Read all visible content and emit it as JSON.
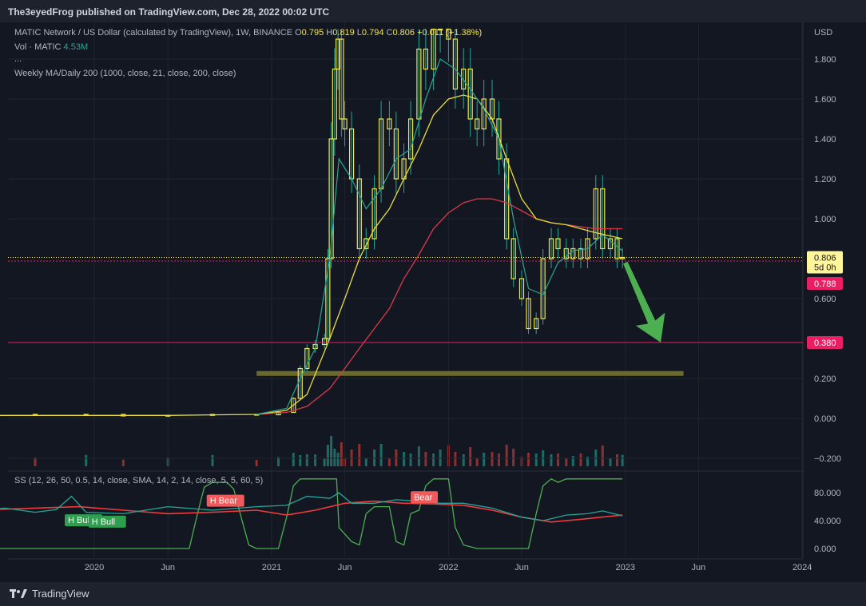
{
  "published_by": "The3eyedFrog published on TradingView.com, Dec 28, 2022 00:02 UTC",
  "brand": "TradingView",
  "legend": {
    "symbol": "MATIC Network / US Dollar (calculated by TradingView), 1W, BINANCE",
    "o_label": "O",
    "o_val": "0.795",
    "h_label": "H",
    "h_val": "0.819",
    "l_label": "L",
    "l_val": "0.794",
    "c_label": "C",
    "c_val": "0.806",
    "change": "+0.011 (+1.38%)",
    "vol_label": "Vol · MATIC",
    "vol_val": "4.53M",
    "more": "...",
    "indicator": "Weekly MA/Daily 200 (1000, close, 21, close, 200, close)",
    "ss": "SS (12, 26, 50, 0.5, 14, close, SMA, 14, 2, 14, close, 5, 5, 60, 5)"
  },
  "colors": {
    "candle": "#f2e64a",
    "wick": "#26a69a",
    "ma_fast": "#26a69a",
    "ma_mid": "#e8de3c",
    "ma_slow": "#d83a4a",
    "support": "#e91e63",
    "zone": "#6b6a2a",
    "arrow": "#4caf50",
    "vol_up": "#1e6b66",
    "vol_down": "#8c3030",
    "ss_green": "#4caf50",
    "ss_red": "#ef3b3b",
    "ss_teal": "#26a69a"
  },
  "chart_data": [
    {
      "type": "candlestick",
      "currency_label": "USD",
      "y_ticks": [
        1.8,
        1.6,
        1.4,
        1.2,
        1.0,
        0.6,
        0.2,
        0.0,
        -0.2
      ],
      "y_tick_labels": [
        "1.800",
        "1.600",
        "1.400",
        "1.200",
        "1.000",
        "0.600",
        "0.200",
        "0.000",
        "−0.200"
      ],
      "ylim": [
        -0.2,
        1.95
      ],
      "x_ticks": [
        "2020",
        "Jun",
        "2021",
        "Jun",
        "2022",
        "Jun",
        "2023",
        "Jun",
        "2024"
      ],
      "x_tick_dates": [
        "2020-01-01",
        "2020-06-01",
        "2021-01-01",
        "2021-06-01",
        "2022-01-01",
        "2022-06-01",
        "2023-01-01",
        "2023-06-01",
        "2024-01-01"
      ],
      "price_labels": [
        {
          "value": "0.806",
          "sub": "5d 0h",
          "level": 0.806
        },
        {
          "value": "0.788",
          "level": 0.788
        },
        {
          "value": "0.380",
          "level": 0.38
        }
      ],
      "support_level": 0.38,
      "zone_level": 0.225,
      "zone_range": [
        "2020-12-01",
        "2023-05-01"
      ],
      "arrow": {
        "from": [
          "2023-01-01",
          0.78
        ],
        "to": [
          "2023-03-15",
          0.38
        ]
      },
      "close_series": [
        [
          "2019-05-01",
          0.02
        ],
        [
          "2019-09-01",
          0.015
        ],
        [
          "2019-12-15",
          0.02
        ],
        [
          "2020-03-01",
          0.012
        ],
        [
          "2020-06-01",
          0.015
        ],
        [
          "2020-09-01",
          0.02
        ],
        [
          "2020-12-01",
          0.018
        ],
        [
          "2021-01-15",
          0.03
        ],
        [
          "2021-02-15",
          0.1
        ],
        [
          "2021-03-01",
          0.25
        ],
        [
          "2021-03-15",
          0.35
        ],
        [
          "2021-04-01",
          0.37
        ],
        [
          "2021-04-20",
          0.4
        ],
        [
          "2021-04-27",
          0.8
        ],
        [
          "2021-05-04",
          1.4
        ],
        [
          "2021-05-11",
          1.75
        ],
        [
          "2021-05-18",
          1.9
        ],
        [
          "2021-05-25",
          1.5
        ],
        [
          "2021-06-01",
          1.45
        ],
        [
          "2021-06-15",
          1.2
        ],
        [
          "2021-07-01",
          0.85
        ],
        [
          "2021-07-15",
          0.9
        ],
        [
          "2021-08-01",
          1.15
        ],
        [
          "2021-08-15",
          1.5
        ],
        [
          "2021-09-01",
          1.45
        ],
        [
          "2021-09-15",
          1.2
        ],
        [
          "2021-10-01",
          1.3
        ],
        [
          "2021-10-15",
          1.5
        ],
        [
          "2021-11-01",
          1.85
        ],
        [
          "2021-11-15",
          1.75
        ],
        [
          "2021-12-01",
          1.95
        ],
        [
          "2021-12-15",
          2.2
        ],
        [
          "2022-01-01",
          1.9
        ],
        [
          "2022-01-15",
          1.65
        ],
        [
          "2022-02-01",
          1.75
        ],
        [
          "2022-02-15",
          1.5
        ],
        [
          "2022-03-01",
          1.45
        ],
        [
          "2022-03-15",
          1.6
        ],
        [
          "2022-04-01",
          1.5
        ],
        [
          "2022-04-15",
          1.3
        ],
        [
          "2022-05-01",
          0.9
        ],
        [
          "2022-05-15",
          0.7
        ],
        [
          "2022-06-01",
          0.6
        ],
        [
          "2022-06-15",
          0.45
        ],
        [
          "2022-07-01",
          0.5
        ],
        [
          "2022-07-15",
          0.8
        ],
        [
          "2022-08-01",
          0.9
        ],
        [
          "2022-08-15",
          0.85
        ],
        [
          "2022-09-01",
          0.8
        ],
        [
          "2022-09-15",
          0.85
        ],
        [
          "2022-10-01",
          0.8
        ],
        [
          "2022-10-15",
          0.9
        ],
        [
          "2022-11-01",
          1.15
        ],
        [
          "2022-11-15",
          0.85
        ],
        [
          "2022-12-01",
          0.9
        ],
        [
          "2022-12-15",
          0.8
        ],
        [
          "2022-12-26",
          0.806
        ]
      ],
      "ma_fast": [
        [
          "2020-12-01",
          0.02
        ],
        [
          "2021-02-01",
          0.05
        ],
        [
          "2021-03-01",
          0.2
        ],
        [
          "2021-04-01",
          0.35
        ],
        [
          "2021-05-01",
          0.8
        ],
        [
          "2021-05-20",
          1.3
        ],
        [
          "2021-06-15",
          1.2
        ],
        [
          "2021-07-15",
          1.05
        ],
        [
          "2021-08-15",
          1.15
        ],
        [
          "2021-09-15",
          1.3
        ],
        [
          "2021-10-15",
          1.35
        ],
        [
          "2021-11-15",
          1.6
        ],
        [
          "2021-12-15",
          1.8
        ],
        [
          "2022-01-15",
          1.75
        ],
        [
          "2022-02-15",
          1.65
        ],
        [
          "2022-03-15",
          1.55
        ],
        [
          "2022-04-15",
          1.4
        ],
        [
          "2022-05-15",
          1.0
        ],
        [
          "2022-06-15",
          0.65
        ],
        [
          "2022-07-15",
          0.62
        ],
        [
          "2022-08-15",
          0.78
        ],
        [
          "2022-09-15",
          0.84
        ],
        [
          "2022-10-15",
          0.85
        ],
        [
          "2022-11-15",
          0.92
        ],
        [
          "2022-12-26",
          0.84
        ]
      ],
      "ma_mid": [
        [
          "2019-05-01",
          0.015
        ],
        [
          "2020-06-01",
          0.015
        ],
        [
          "2020-12-01",
          0.02
        ],
        [
          "2021-02-01",
          0.04
        ],
        [
          "2021-03-15",
          0.12
        ],
        [
          "2021-05-01",
          0.4
        ],
        [
          "2021-06-01",
          0.6
        ],
        [
          "2021-07-01",
          0.8
        ],
        [
          "2021-08-01",
          0.95
        ],
        [
          "2021-09-01",
          1.05
        ],
        [
          "2021-10-01",
          1.2
        ],
        [
          "2021-11-01",
          1.35
        ],
        [
          "2021-12-01",
          1.52
        ],
        [
          "2022-01-01",
          1.6
        ],
        [
          "2022-02-01",
          1.62
        ],
        [
          "2022-03-01",
          1.6
        ],
        [
          "2022-04-01",
          1.5
        ],
        [
          "2022-05-01",
          1.3
        ],
        [
          "2022-06-01",
          1.1
        ],
        [
          "2022-07-01",
          1.0
        ],
        [
          "2022-08-01",
          0.98
        ],
        [
          "2022-09-01",
          0.97
        ],
        [
          "2022-10-01",
          0.95
        ],
        [
          "2022-11-01",
          0.93
        ],
        [
          "2022-12-26",
          0.9
        ]
      ],
      "ma_slow": [
        [
          "2020-12-01",
          0.02
        ],
        [
          "2021-02-01",
          0.03
        ],
        [
          "2021-03-15",
          0.06
        ],
        [
          "2021-05-01",
          0.15
        ],
        [
          "2021-06-01",
          0.25
        ],
        [
          "2021-07-01",
          0.35
        ],
        [
          "2021-08-01",
          0.45
        ],
        [
          "2021-09-01",
          0.55
        ],
        [
          "2021-10-01",
          0.7
        ],
        [
          "2021-11-01",
          0.82
        ],
        [
          "2021-12-01",
          0.95
        ],
        [
          "2022-01-01",
          1.03
        ],
        [
          "2022-02-01",
          1.08
        ],
        [
          "2022-03-01",
          1.1
        ],
        [
          "2022-04-01",
          1.1
        ],
        [
          "2022-05-01",
          1.08
        ],
        [
          "2022-06-01",
          1.04
        ],
        [
          "2022-07-01",
          1.0
        ],
        [
          "2022-08-01",
          0.98
        ],
        [
          "2022-09-01",
          0.97
        ],
        [
          "2022-10-01",
          0.96
        ],
        [
          "2022-11-01",
          0.95
        ],
        [
          "2022-12-26",
          0.95
        ]
      ]
    },
    {
      "type": "line",
      "title": "SS",
      "y_ticks": [
        80,
        40,
        0
      ],
      "y_tick_labels": [
        "80.000",
        "40.000",
        "0.000"
      ],
      "ylim": [
        -5,
        110
      ],
      "labels": [
        {
          "text": "H Bull",
          "kind": "bull",
          "date": "2019-11-01",
          "value": 40
        },
        {
          "text": "H Bull",
          "kind": "bull",
          "date": "2019-12-20",
          "value": 38
        },
        {
          "text": "H Bear",
          "kind": "bear",
          "date": "2020-08-20",
          "value": 68
        },
        {
          "text": "Bear",
          "kind": "bear",
          "date": "2021-10-15",
          "value": 73
        }
      ],
      "teal": [
        [
          "2019-05-01",
          55
        ],
        [
          "2019-07-01",
          58
        ],
        [
          "2019-09-01",
          52
        ],
        [
          "2019-10-15",
          56
        ],
        [
          "2019-11-15",
          75
        ],
        [
          "2019-12-15",
          52
        ],
        [
          "2020-03-01",
          50
        ],
        [
          "2020-06-01",
          60
        ],
        [
          "2020-09-01",
          55
        ],
        [
          "2020-12-01",
          60
        ],
        [
          "2021-02-01",
          62
        ],
        [
          "2021-03-15",
          75
        ],
        [
          "2021-05-01",
          72
        ],
        [
          "2021-05-20",
          80
        ],
        [
          "2021-06-15",
          65
        ],
        [
          "2021-08-01",
          65
        ],
        [
          "2021-09-15",
          70
        ],
        [
          "2021-11-01",
          68
        ],
        [
          "2021-12-15",
          65
        ],
        [
          "2022-02-01",
          65
        ],
        [
          "2022-04-01",
          58
        ],
        [
          "2022-06-01",
          45
        ],
        [
          "2022-07-15",
          40
        ],
        [
          "2022-09-01",
          48
        ],
        [
          "2022-10-15",
          50
        ],
        [
          "2022-11-15",
          54
        ],
        [
          "2022-12-26",
          47
        ]
      ],
      "red": [
        [
          "2019-05-01",
          55
        ],
        [
          "2019-09-01",
          58
        ],
        [
          "2019-12-01",
          60
        ],
        [
          "2020-03-01",
          55
        ],
        [
          "2020-06-01",
          50
        ],
        [
          "2020-09-01",
          52
        ],
        [
          "2020-12-01",
          55
        ],
        [
          "2021-02-01",
          48
        ],
        [
          "2021-04-01",
          55
        ],
        [
          "2021-06-01",
          65
        ],
        [
          "2021-08-01",
          68
        ],
        [
          "2021-10-01",
          65
        ],
        [
          "2021-12-01",
          64
        ],
        [
          "2022-02-01",
          62
        ],
        [
          "2022-04-01",
          55
        ],
        [
          "2022-06-01",
          45
        ],
        [
          "2022-08-01",
          38
        ],
        [
          "2022-10-01",
          42
        ],
        [
          "2022-12-26",
          48
        ]
      ],
      "green": [
        [
          "2019-05-01",
          0
        ],
        [
          "2020-07-15",
          0
        ],
        [
          "2020-08-01",
          50
        ],
        [
          "2020-08-15",
          88
        ],
        [
          "2020-09-01",
          95
        ],
        [
          "2020-10-01",
          95
        ],
        [
          "2020-10-15",
          85
        ],
        [
          "2020-11-01",
          40
        ],
        [
          "2020-11-15",
          5
        ],
        [
          "2020-12-01",
          0
        ],
        [
          "2021-01-15",
          0
        ],
        [
          "2021-02-01",
          45
        ],
        [
          "2021-02-15",
          90
        ],
        [
          "2021-03-01",
          100
        ],
        [
          "2021-05-15",
          100
        ],
        [
          "2021-05-20",
          30
        ],
        [
          "2021-06-15",
          10
        ],
        [
          "2021-07-01",
          5
        ],
        [
          "2021-07-15",
          50
        ],
        [
          "2021-08-01",
          60
        ],
        [
          "2021-09-01",
          60
        ],
        [
          "2021-09-15",
          10
        ],
        [
          "2021-10-01",
          5
        ],
        [
          "2021-10-15",
          50
        ],
        [
          "2021-11-01",
          55
        ],
        [
          "2021-11-15",
          90
        ],
        [
          "2021-12-01",
          100
        ],
        [
          "2022-01-01",
          100
        ],
        [
          "2022-01-15",
          30
        ],
        [
          "2022-02-01",
          5
        ],
        [
          "2022-03-01",
          0
        ],
        [
          "2022-06-15",
          0
        ],
        [
          "2022-07-01",
          50
        ],
        [
          "2022-07-15",
          90
        ],
        [
          "2022-08-01",
          100
        ],
        [
          "2022-08-15",
          95
        ],
        [
          "2022-09-01",
          100
        ],
        [
          "2022-12-26",
          100
        ]
      ]
    }
  ]
}
